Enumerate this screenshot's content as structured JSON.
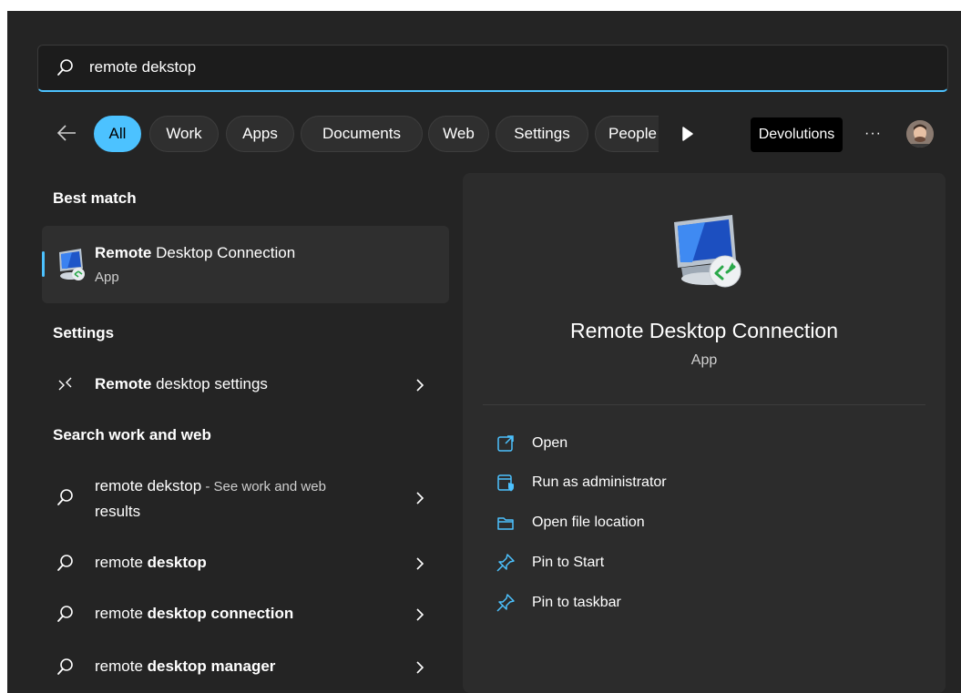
{
  "search": {
    "query": "remote dekstop"
  },
  "filters": {
    "back_label": "Back",
    "chips": [
      "All",
      "Work",
      "Apps",
      "Documents",
      "Web",
      "Settings",
      "People"
    ],
    "devolutions": "Devolutions",
    "more": "···"
  },
  "left": {
    "best_match_heading": "Best match",
    "best_match": {
      "title_bold": "Remote",
      "title_rest": " Desktop Connection",
      "subtitle": "App"
    },
    "settings_heading": "Settings",
    "settings_item": {
      "bold": "Remote",
      "rest": " desktop settings"
    },
    "web_heading": "Search work and web",
    "web_items": [
      {
        "prefix": "remote dekstop",
        "bold": "",
        "suffix": " - See work and web",
        "line2": "results"
      },
      {
        "prefix": "remote ",
        "bold": "desktop",
        "suffix": "",
        "line2": ""
      },
      {
        "prefix": "remote ",
        "bold": "desktop connection",
        "suffix": "",
        "line2": ""
      },
      {
        "prefix": "remote ",
        "bold": "desktop manager",
        "suffix": "",
        "line2": ""
      }
    ]
  },
  "preview": {
    "title": "Remote Desktop Connection",
    "subtitle": "App",
    "actions": [
      {
        "label": "Open",
        "icon": "open-external-icon"
      },
      {
        "label": "Run as administrator",
        "icon": "admin-shield-icon"
      },
      {
        "label": "Open file location",
        "icon": "folder-icon"
      },
      {
        "label": "Pin to Start",
        "icon": "pin-icon"
      },
      {
        "label": "Pin to taskbar",
        "icon": "pin-icon"
      }
    ]
  },
  "colors": {
    "accent": "#4cc2ff",
    "panel": "#242424",
    "preview": "#2c2c2c"
  }
}
